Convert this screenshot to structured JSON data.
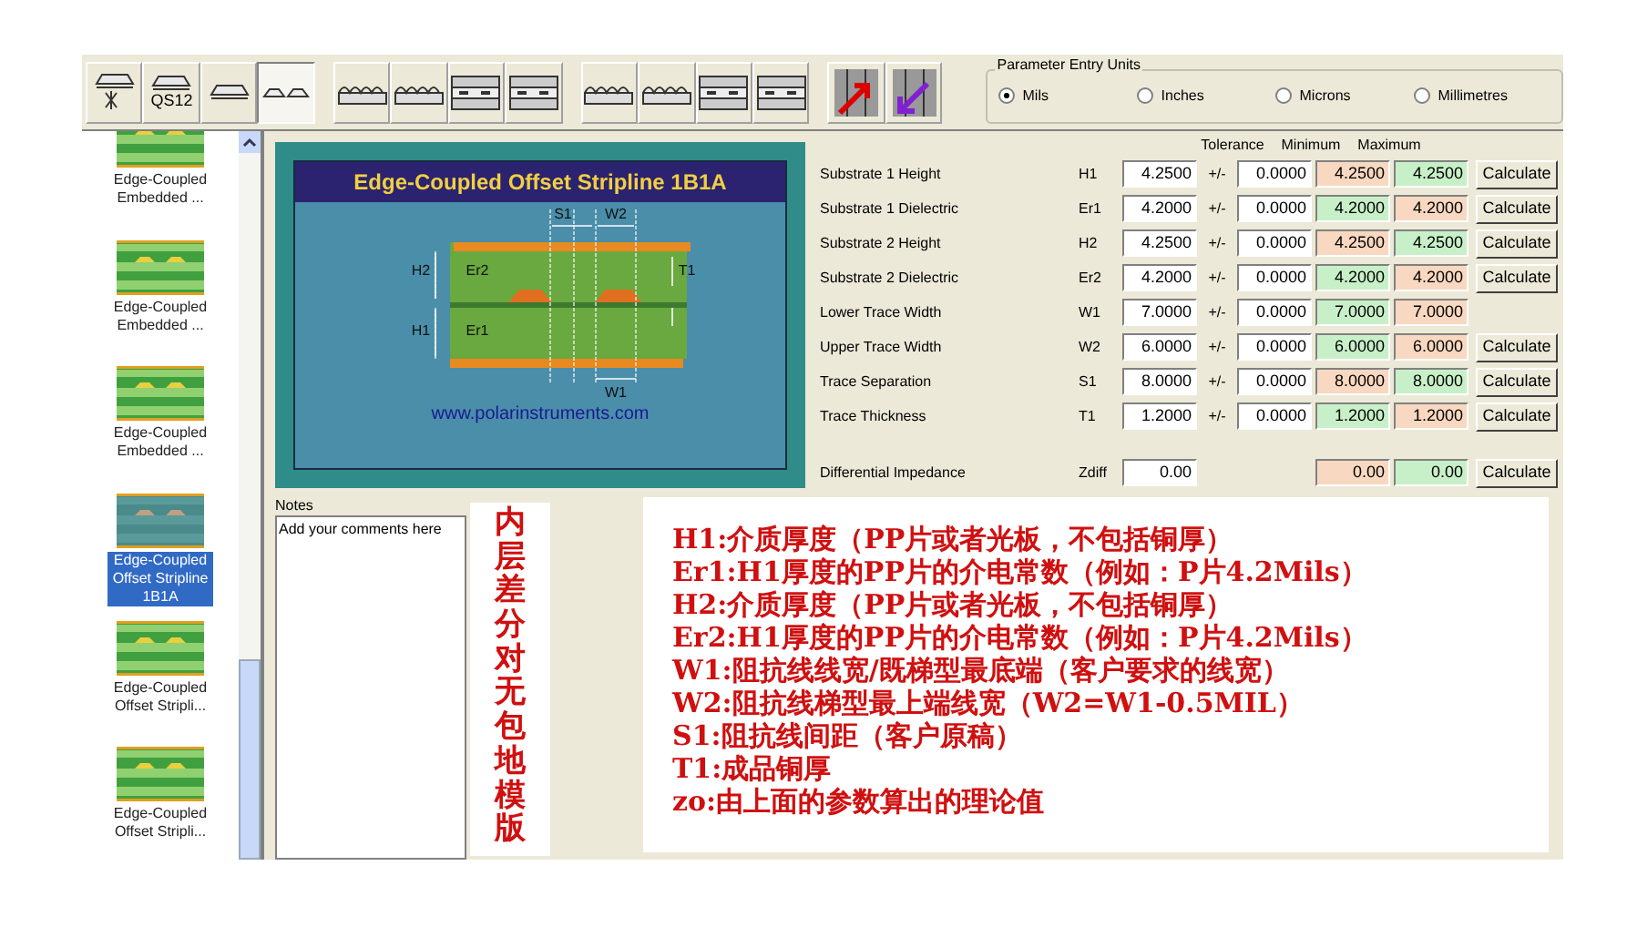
{
  "toolbar": [
    {
      "kind": "trace-star",
      "selected": false
    },
    {
      "kind": "trace",
      "label": "QS12",
      "selected": false
    },
    {
      "kind": "trace",
      "selected": false
    },
    {
      "kind": "pair",
      "selected": true
    },
    {
      "kind": "coated",
      "selected": false
    },
    {
      "kind": "coated",
      "selected": false
    },
    {
      "kind": "buried",
      "selected": false
    },
    {
      "kind": "buried",
      "selected": false
    },
    {
      "kind": "coated",
      "selected": false
    },
    {
      "kind": "coated",
      "selected": false
    },
    {
      "kind": "buried",
      "selected": false
    },
    {
      "kind": "buried",
      "selected": false
    },
    {
      "kind": "arrow-out",
      "selected": false
    },
    {
      "kind": "arrow-in",
      "selected": false
    }
  ],
  "units": {
    "title": "Parameter Entry Units",
    "options": [
      {
        "label": "Mils",
        "selected": true
      },
      {
        "label": "Inches",
        "selected": false
      },
      {
        "label": "Microns",
        "selected": false
      },
      {
        "label": "Millimetres",
        "selected": false
      }
    ]
  },
  "structures": [
    {
      "label": "Edge-Coupled Embedded ...",
      "selected": false
    },
    {
      "label": "Edge-Coupled Embedded ...",
      "selected": false
    },
    {
      "label": "Edge-Coupled Embedded ...",
      "selected": false
    },
    {
      "label": "Edge-Coupled Offset Stripline 1B1A",
      "selected": true
    },
    {
      "label": "Edge-Coupled Offset Stripli...",
      "selected": false
    },
    {
      "label": "Edge-Coupled Offset Stripli...",
      "selected": false
    }
  ],
  "diagram": {
    "title": "Edge-Coupled Offset Stripline 1B1A",
    "url": "www.polarinstruments.com",
    "labels": [
      "S1",
      "W2",
      "H2",
      "Er2",
      "T1",
      "H1",
      "Er1",
      "W1"
    ]
  },
  "params": {
    "headers": [
      "Tolerance",
      "Minimum",
      "Maximum"
    ],
    "rows": [
      {
        "label": "Substrate 1 Height",
        "symbol": "H1",
        "value": "4.2500",
        "pm": "+/-",
        "tolerance": "0.0000",
        "minimum": {
          "text": "4.2500",
          "color": "#f8d8c0"
        },
        "maximum": {
          "text": "4.2500",
          "color": "#c8f0c8"
        },
        "button": "Calculate"
      },
      {
        "label": "Substrate 1 Dielectric",
        "symbol": "Er1",
        "value": "4.2000",
        "pm": "+/-",
        "tolerance": "0.0000",
        "minimum": {
          "text": "4.2000",
          "color": "#c8f0c8"
        },
        "maximum": {
          "text": "4.2000",
          "color": "#f8d8c0"
        },
        "button": "Calculate"
      },
      {
        "label": "Substrate 2 Height",
        "symbol": "H2",
        "value": "4.2500",
        "pm": "+/-",
        "tolerance": "0.0000",
        "minimum": {
          "text": "4.2500",
          "color": "#f8d8c0"
        },
        "maximum": {
          "text": "4.2500",
          "color": "#c8f0c8"
        },
        "button": "Calculate"
      },
      {
        "label": "Substrate 2 Dielectric",
        "symbol": "Er2",
        "value": "4.2000",
        "pm": "+/-",
        "tolerance": "0.0000",
        "minimum": {
          "text": "4.2000",
          "color": "#c8f0c8"
        },
        "maximum": {
          "text": "4.2000",
          "color": "#f8d8c0"
        },
        "button": "Calculate"
      },
      {
        "label": "Lower Trace Width",
        "symbol": "W1",
        "value": "7.0000",
        "pm": "+/-",
        "tolerance": "0.0000",
        "minimum": {
          "text": "7.0000",
          "color": "#c8f0c8"
        },
        "maximum": {
          "text": "7.0000",
          "color": "#f8d8c0"
        }
      },
      {
        "label": "Upper Trace Width",
        "symbol": "W2",
        "value": "6.0000",
        "pm": "+/-",
        "tolerance": "0.0000",
        "minimum": {
          "text": "6.0000",
          "color": "#c8f0c8"
        },
        "maximum": {
          "text": "6.0000",
          "color": "#f8d8c0"
        },
        "button": "Calculate"
      },
      {
        "label": "Trace Separation",
        "symbol": "S1",
        "value": "8.0000",
        "pm": "+/-",
        "tolerance": "0.0000",
        "minimum": {
          "text": "8.0000",
          "color": "#f8d8c0"
        },
        "maximum": {
          "text": "8.0000",
          "color": "#c8f0c8"
        },
        "button": "Calculate"
      },
      {
        "label": "Trace Thickness",
        "symbol": "T1",
        "value": "1.2000",
        "pm": "+/-",
        "tolerance": "0.0000",
        "minimum": {
          "text": "1.2000",
          "color": "#c8f0c8"
        },
        "maximum": {
          "text": "1.2000",
          "color": "#f8d8c0"
        },
        "button": "Calculate"
      }
    ],
    "result": {
      "label": "Differential Impedance",
      "symbol": "Zdiff",
      "value": "0.00",
      "minimum": {
        "text": "0.00",
        "color": "#f8d8c0"
      },
      "maximum": {
        "text": "0.00",
        "color": "#c8f0c8"
      },
      "button": "Calculate"
    }
  },
  "notes": {
    "title": "Notes",
    "placeholder": "Add your comments here"
  },
  "overlay_vertical": "内层差分对无包地模版",
  "overlay_lines": [
    "H1:介质厚度（PP片或者光板，不包括铜厚）",
    "Er1:H1厚度的PP片的介电常数（例如：P片4.2Mils）",
    "H2:介质厚度（PP片或者光板，不包括铜厚）",
    "Er2:H1厚度的PP片的介电常数（例如：P片4.2Mils）",
    "W1:阻抗线线宽/既梯型最底端（客户要求的线宽）",
    "W2:阻抗线梯型最上端线宽（W2=W1-0.5MIL）",
    "S1:阻抗线间距（客户原稿）",
    "T1:成品铜厚",
    "zo:由上面的参数算出的理论值"
  ]
}
